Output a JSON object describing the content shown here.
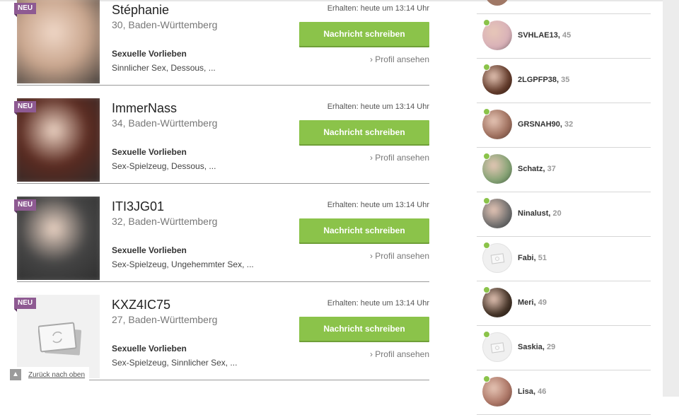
{
  "badge_text": "NEU",
  "prefs_label": "Sexuelle Vorlieben",
  "button_label": "Nachricht schreiben",
  "profile_link": "Profil ansehen",
  "back_to_top": "Zurück nach oben",
  "matches": [
    {
      "name": "Stéphanie",
      "location": "30, Baden-Württemberg",
      "received": "Erhalten: heute um 13:14 Uhr",
      "prefs": "Sinnlicher Sex, Dessous, ...",
      "photo": "blurred",
      "tone": "#c9a68e"
    },
    {
      "name": "ImmerNass",
      "location": "34, Baden-Württemberg",
      "received": "Erhalten: heute um 13:14 Uhr",
      "prefs": "Sex-Spielzeug, Dessous, ...",
      "photo": "blurred",
      "tone": "#5a2a20"
    },
    {
      "name": "ITI3JG01",
      "location": "32, Baden-Württemberg",
      "received": "Erhalten: heute um 13:14 Uhr",
      "prefs": "Sex-Spielzeug, Ungehemmter Sex, ...",
      "photo": "blurred",
      "tone": "#444444"
    },
    {
      "name": "KXZ4IC75",
      "location": "27, Baden-Württemberg",
      "received": "Erhalten: heute um 13:14 Uhr",
      "prefs": "Sex-Spielzeug, Sinnlicher Sex, ...",
      "photo": "placeholder",
      "tone": "#f1f1f1"
    }
  ],
  "sidebar": [
    {
      "name": "SVHLAE13",
      "age": "45",
      "photo": "blurred",
      "tone": "#d8b0b8"
    },
    {
      "name": "2LGPFP38",
      "age": "35",
      "photo": "blurred",
      "tone": "#5a3222"
    },
    {
      "name": "GRSNAH90",
      "age": "32",
      "photo": "blurred",
      "tone": "#9a6a58"
    },
    {
      "name": "Schatz",
      "age": "37",
      "photo": "blurred",
      "tone": "#7fa070"
    },
    {
      "name": "Ninalust",
      "age": "20",
      "photo": "blurred",
      "tone": "#6a6a6a"
    },
    {
      "name": "Fabi",
      "age": "51",
      "photo": "placeholder",
      "tone": "#f0f0f0"
    },
    {
      "name": "Meri",
      "age": "49",
      "photo": "blurred",
      "tone": "#3a2a1e"
    },
    {
      "name": "Saskia",
      "age": "29",
      "photo": "placeholder",
      "tone": "#f0f0f0"
    },
    {
      "name": "Lisa",
      "age": "46",
      "photo": "blurred",
      "tone": "#a87060"
    }
  ]
}
